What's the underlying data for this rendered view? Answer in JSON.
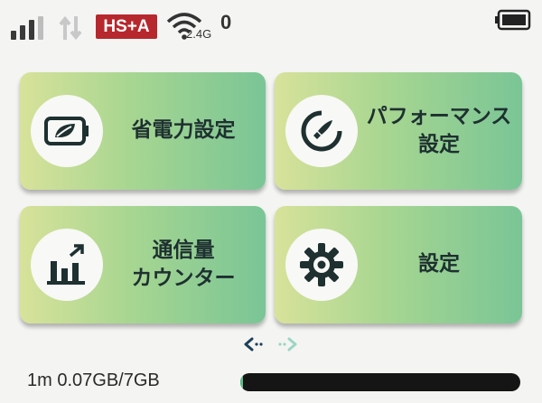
{
  "status_bar": {
    "network_type": "HS+A",
    "wifi_band": "2.4G",
    "connected_clients": "0",
    "signal_bars": 3,
    "battery_level": 1.0
  },
  "tiles": [
    {
      "label": "省電力設定",
      "icon": "battery-leaf-icon"
    },
    {
      "label": "パフォーマンス\n設定",
      "icon": "rocket-icon"
    },
    {
      "label": "通信量\nカウンター",
      "icon": "bar-chart-icon"
    },
    {
      "label": "設定",
      "icon": "gear-icon"
    }
  ],
  "pager": {
    "current_page": 1,
    "total_pages": 2
  },
  "data_usage": {
    "text": "1m 0.07GB/7GB",
    "used_fraction": 0.01
  },
  "colors": {
    "tile_gradient_start": "#d8e29a",
    "tile_gradient_end": "#7ac596",
    "badge": "#b6282d",
    "bar": "#151515"
  }
}
